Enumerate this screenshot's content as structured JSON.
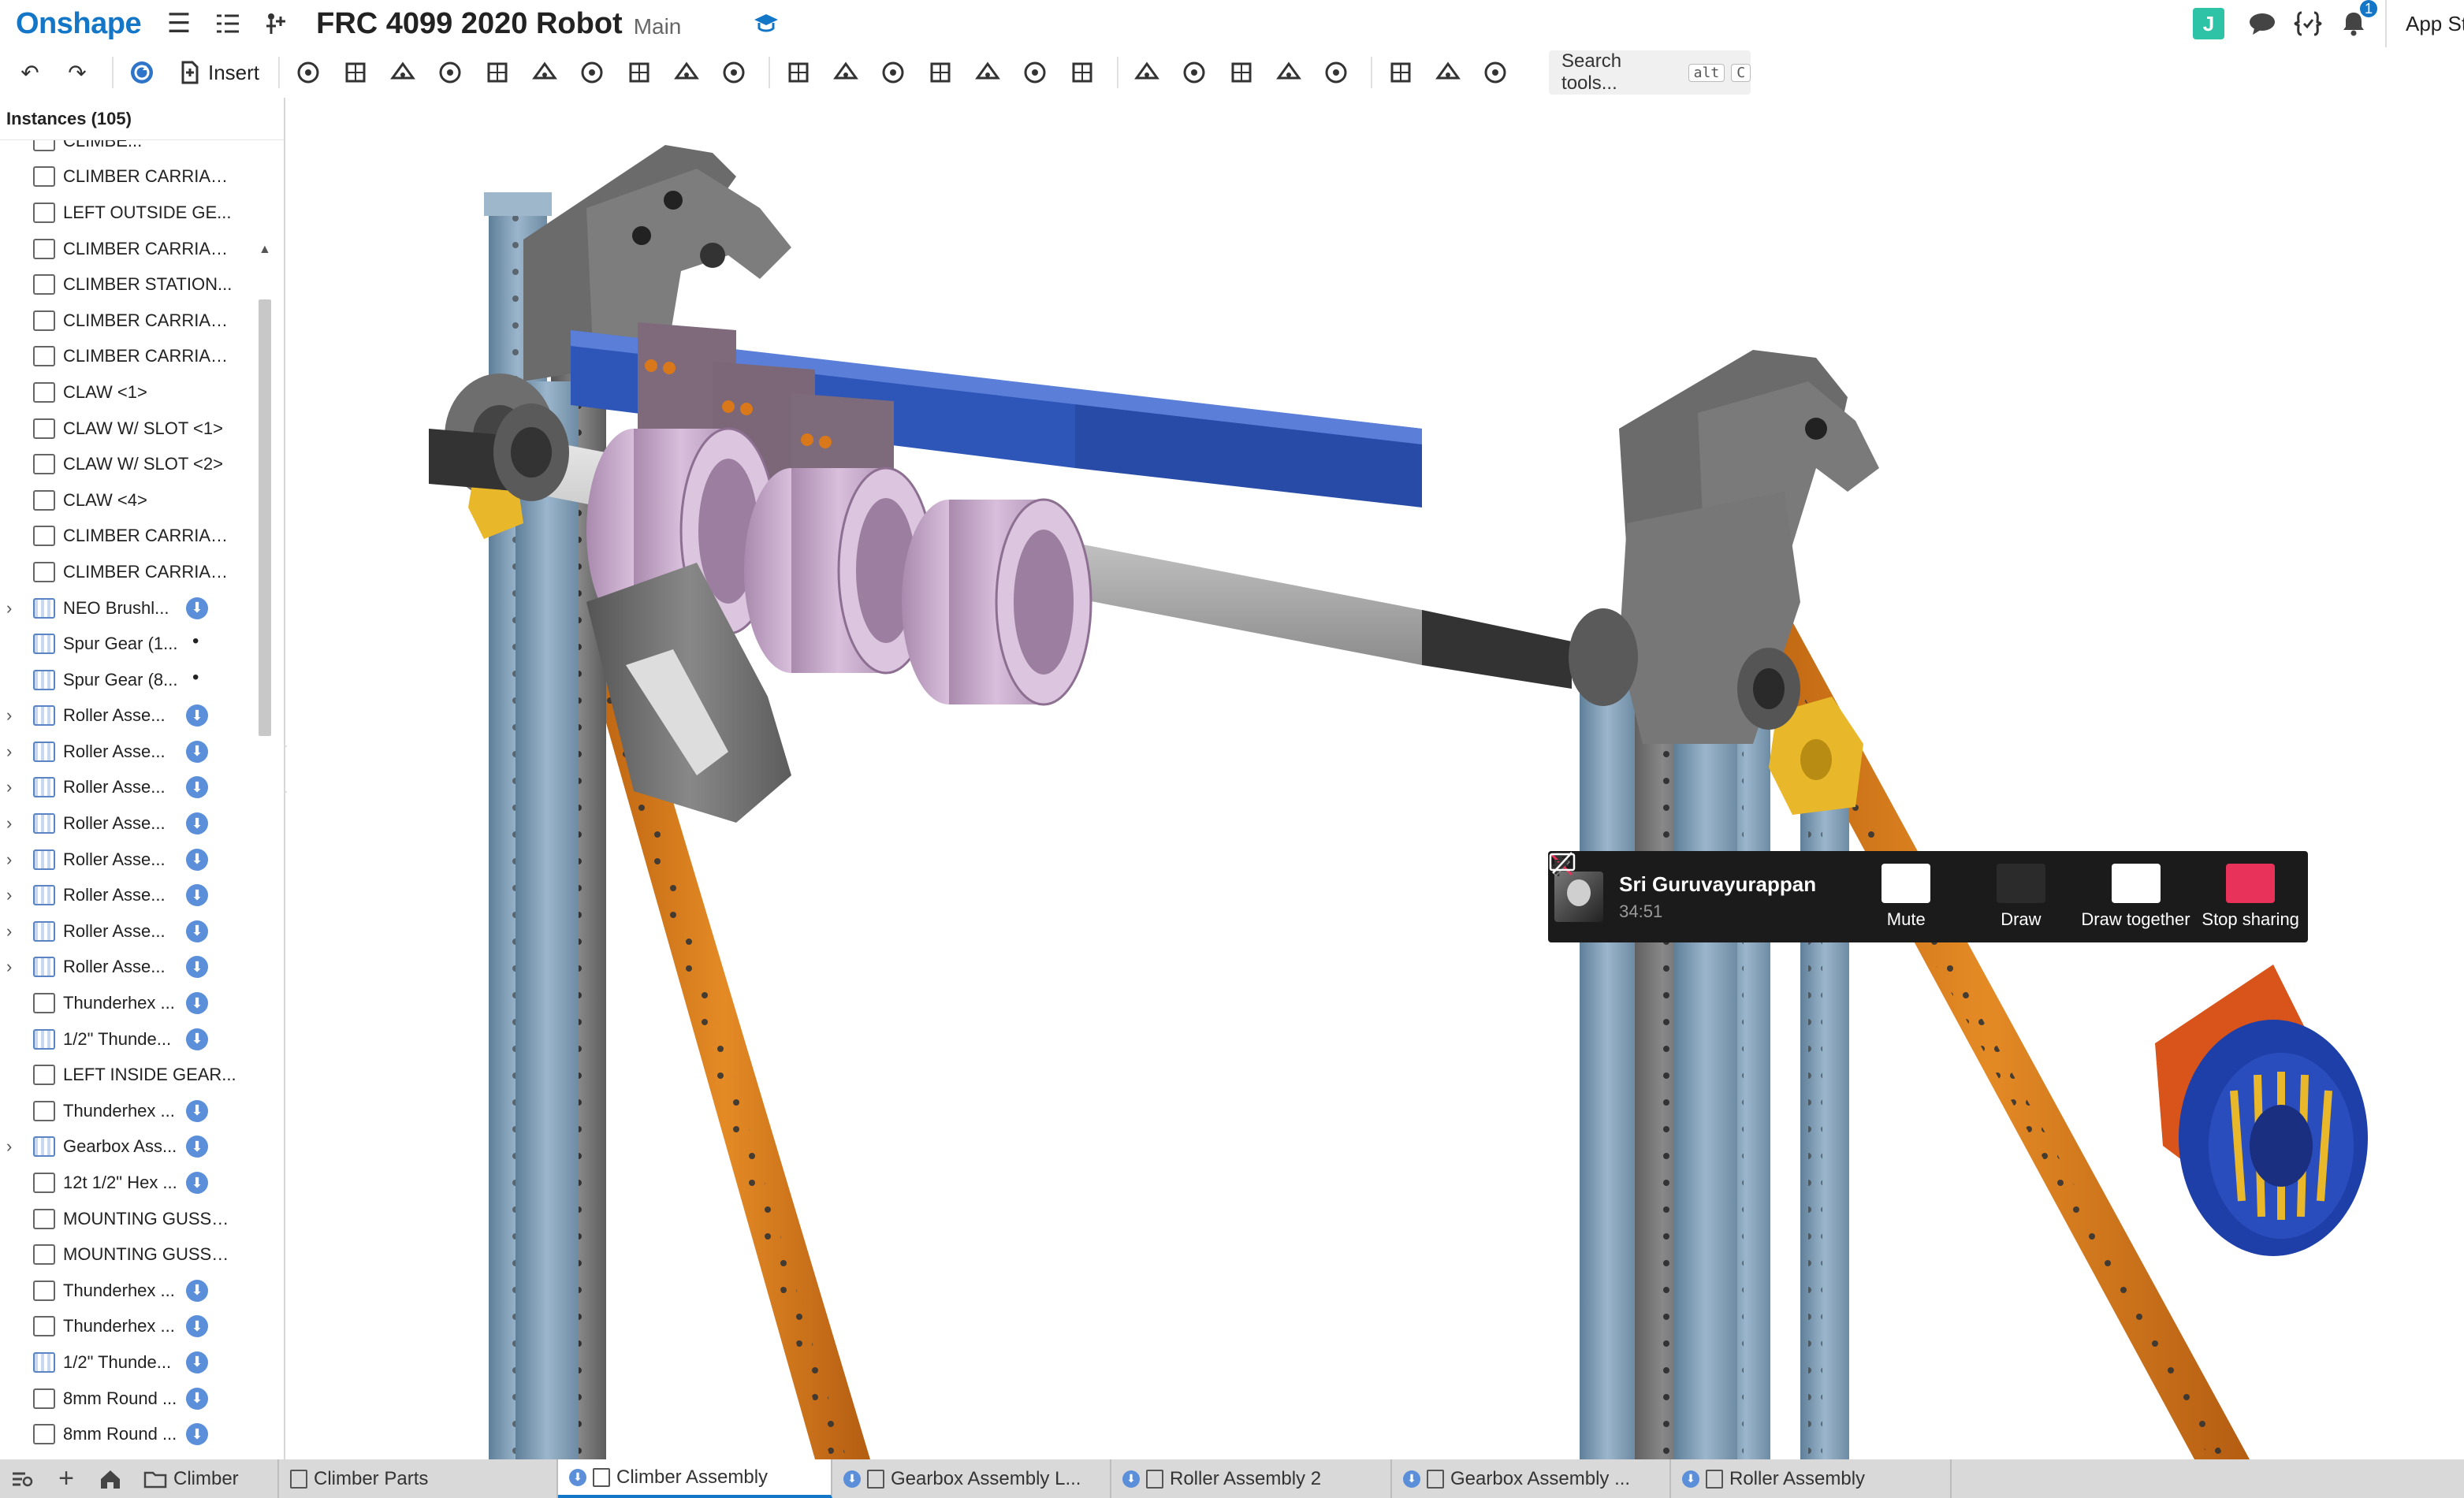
{
  "app": {
    "logo": "Onshape",
    "title": "FRC 4099 2020 Robot",
    "branch": "Main"
  },
  "topbar_right": {
    "avatar_initial": "J",
    "notification_count": "1",
    "app_store": "App Store"
  },
  "toolbar": {
    "insert_label": "Insert",
    "search": {
      "label": "Search tools...",
      "kbd1": "alt",
      "kbd2": "C"
    },
    "icons": [
      "undo-icon",
      "redo-icon",
      "update-icon",
      "insert-icon",
      "mate-connector-icon",
      "fastened-mate-icon",
      "revolute-mate-icon",
      "slider-mate-icon",
      "planar-mate-icon",
      "cylindrical-mate-icon",
      "pin-slot-mate-icon",
      "ball-mate-icon",
      "parallel-mate-icon",
      "tangent-mate-icon",
      "linear-pattern-icon",
      "circular-pattern-icon",
      "replicate-icon",
      "group-icon",
      "relation-icon",
      "gear-relation-icon",
      "rack-pinion-icon",
      "screw-relation-icon",
      "mate-values-icon",
      "explode-icon",
      "named-positions-icon",
      "measure-icon",
      "section-view-icon",
      "display-states-icon",
      "view-cube-icon"
    ]
  },
  "panel": {
    "header": "Instances (105)",
    "items": [
      {
        "label": "CLIMBE...",
        "type": "part",
        "expand": false,
        "badge": "none"
      },
      {
        "label": "CLIMBER CARRIAG...",
        "type": "part",
        "expand": false,
        "badge": "none"
      },
      {
        "label": "LEFT OUTSIDE GE...",
        "type": "part",
        "expand": false,
        "badge": "none"
      },
      {
        "label": "CLIMBER CARRIAG...",
        "type": "part",
        "expand": false,
        "badge": "none"
      },
      {
        "label": "CLIMBER STATION...",
        "type": "part",
        "expand": false,
        "badge": "none"
      },
      {
        "label": "CLIMBER CARRIAG...",
        "type": "part",
        "expand": false,
        "badge": "none"
      },
      {
        "label": "CLIMBER CARRIAG...",
        "type": "part",
        "expand": false,
        "badge": "none"
      },
      {
        "label": "CLAW <1>",
        "type": "part",
        "expand": false,
        "badge": "none"
      },
      {
        "label": "CLAW W/ SLOT <1>",
        "type": "part",
        "expand": false,
        "badge": "none"
      },
      {
        "label": "CLAW W/ SLOT <2>",
        "type": "part",
        "expand": false,
        "badge": "none"
      },
      {
        "label": "CLAW <4>",
        "type": "part",
        "expand": false,
        "badge": "none"
      },
      {
        "label": "CLIMBER CARRIAG...",
        "type": "part",
        "expand": false,
        "badge": "none"
      },
      {
        "label": "CLIMBER CARRIAG...",
        "type": "part",
        "expand": false,
        "badge": "none"
      },
      {
        "label": "NEO Brushl...",
        "type": "asm",
        "expand": true,
        "badge": "mate"
      },
      {
        "label": "Spur Gear (1...",
        "type": "asm",
        "expand": false,
        "badge": "dot"
      },
      {
        "label": "Spur Gear (8...",
        "type": "asm",
        "expand": false,
        "badge": "dot"
      },
      {
        "label": "Roller Asse...",
        "type": "asm",
        "expand": true,
        "badge": "mate"
      },
      {
        "label": "Roller Asse...",
        "type": "asm",
        "expand": true,
        "badge": "mate"
      },
      {
        "label": "Roller Asse...",
        "type": "asm",
        "expand": true,
        "badge": "mate"
      },
      {
        "label": "Roller Asse...",
        "type": "asm",
        "expand": true,
        "badge": "mate"
      },
      {
        "label": "Roller Asse...",
        "type": "asm",
        "expand": true,
        "badge": "mate"
      },
      {
        "label": "Roller Asse...",
        "type": "asm",
        "expand": true,
        "badge": "mate"
      },
      {
        "label": "Roller Asse...",
        "type": "asm",
        "expand": true,
        "badge": "mate"
      },
      {
        "label": "Roller Asse...",
        "type": "asm",
        "expand": true,
        "badge": "mate"
      },
      {
        "label": "Thunderhex ...",
        "type": "part",
        "expand": false,
        "badge": "mate"
      },
      {
        "label": "1/2\" Thunde...",
        "type": "asm",
        "expand": false,
        "badge": "mate"
      },
      {
        "label": "LEFT INSIDE GEAR...",
        "type": "part",
        "expand": false,
        "badge": "none"
      },
      {
        "label": "Thunderhex ...",
        "type": "part",
        "expand": false,
        "badge": "mate"
      },
      {
        "label": "Gearbox Ass...",
        "type": "asm",
        "expand": true,
        "badge": "mate"
      },
      {
        "label": "12t 1/2\" Hex ...",
        "type": "part",
        "expand": false,
        "badge": "mate"
      },
      {
        "label": "MOUNTING GUSSE...",
        "type": "part",
        "expand": false,
        "badge": "none"
      },
      {
        "label": "MOUNTING GUSSE...",
        "type": "part",
        "expand": false,
        "badge": "none"
      },
      {
        "label": "Thunderhex ...",
        "type": "part",
        "expand": false,
        "badge": "mate"
      },
      {
        "label": "Thunderhex ...",
        "type": "part",
        "expand": false,
        "badge": "mate"
      },
      {
        "label": "1/2\" Thunde...",
        "type": "asm",
        "expand": false,
        "badge": "mate"
      },
      {
        "label": "8mm Round ...",
        "type": "part",
        "expand": false,
        "badge": "mate"
      },
      {
        "label": "8mm Round ...",
        "type": "part",
        "expand": false,
        "badge": "mate"
      }
    ]
  },
  "share": {
    "name": "Sri Guruvayurappan",
    "time": "34:51",
    "mute": "Mute",
    "draw": "Draw",
    "draw_together": "Draw together",
    "stop_sharing": "Stop sharing"
  },
  "tabs": [
    {
      "label": "Climber",
      "kind": "folder",
      "active": false
    },
    {
      "label": "Climber Parts",
      "kind": "part",
      "active": false
    },
    {
      "label": "Climber Assembly",
      "kind": "asm",
      "active": true
    },
    {
      "label": "Gearbox Assembly L...",
      "kind": "asm",
      "active": false
    },
    {
      "label": "Roller Assembly 2",
      "kind": "asm",
      "active": false
    },
    {
      "label": "Gearbox Assembly ...",
      "kind": "asm",
      "active": false
    },
    {
      "label": "Roller Assembly",
      "kind": "asm",
      "active": false
    }
  ],
  "colors": {
    "brand": "#1476c6",
    "accent_green": "#2ec3a6",
    "stop_sharing": "#e8325a",
    "tube_light": "#7a9ab5",
    "tube_orange": "#d9781a",
    "tube_blue": "#2e55b8",
    "roller_pink": "#c9a8cc",
    "plate_grey": "#6f6f6f",
    "gold": "#e8b82a"
  }
}
